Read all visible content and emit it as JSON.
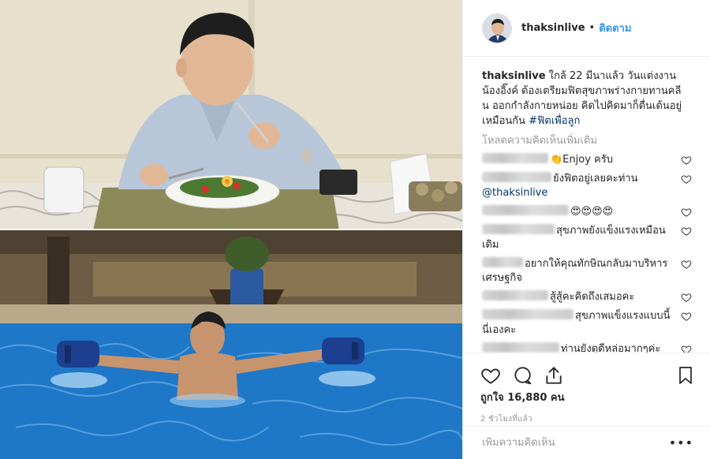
{
  "post": {
    "username": "thaksinlive",
    "follow_label": "ติดตาม",
    "caption_text": " ใกล้ 22 มีนาแล้ว วันแต่งงานน้องอิ๊งค์ ต้องเตรียมฟิตสุขภาพร่างกายทานคลีน ออกกำลังกายหน่อย คิดไปคิดมาก็ตื่นเต้นอยู่เหมือนกัน ",
    "hashtag": "#ฟิตเพื่อลูก",
    "load_more": "โหลดความคิดเห็นเพิ่มเติม",
    "likes_text": "ถูกใจ 16,880 คน",
    "timestamp": "2 ชั่วโมงที่แล้ว",
    "add_comment_placeholder": "เพิ่มความคิดเห็น",
    "more_options": "•••"
  },
  "comments": [
    {
      "text": "👏Enjoy ครับ"
    },
    {
      "text": "ยังฟิตอยู่เลยคะท่าน",
      "mention": "@thaksinlive"
    },
    {
      "text": "😍😍😍😍"
    },
    {
      "text": "สุขภาพยังแข็งแรงเหมือนเดิม"
    },
    {
      "text": "อยากให้คุณทักษิณกลับมาบริหารเศรษฐกิจ"
    },
    {
      "text": "สู้สู้คะคิดถึงเสมอคะ"
    },
    {
      "text": "สุขภาพแข็งแรงแบบนี้นี่เองคะ"
    },
    {
      "text": "ท่านยังดูดีหล่อมากๆค่ะ สุขภาพแข็งแรงด้วยนะคะ"
    }
  ],
  "icons": {
    "heart": "heart-icon",
    "comment": "comment-icon",
    "share": "share-icon",
    "bookmark": "bookmark-icon",
    "more": "more-options-icon"
  },
  "colors": {
    "link_blue": "#3897f0",
    "hashtag": "#003569",
    "muted": "#999999",
    "text": "#262626",
    "border": "#efefef"
  }
}
